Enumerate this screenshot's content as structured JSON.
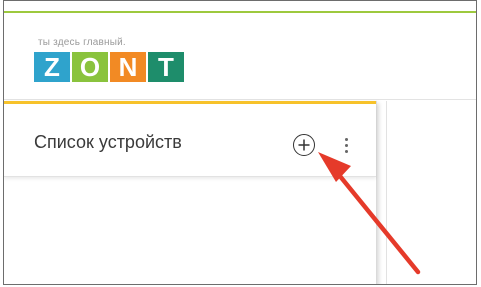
{
  "header": {
    "tagline": "ты здесь главный.",
    "logo_letters": [
      "Z",
      "O",
      "N",
      "T"
    ],
    "brand_colors": {
      "accent_line": "#9dc93e",
      "panel_accent": "#f7c22a"
    }
  },
  "device_panel": {
    "title": "Список устройств",
    "add_icon": "plus-circle-icon",
    "menu_icon": "more-vertical-icon"
  },
  "annotation": {
    "arrow_color": "#e53a2a",
    "arrow_icon": "pointer-arrow-icon"
  }
}
